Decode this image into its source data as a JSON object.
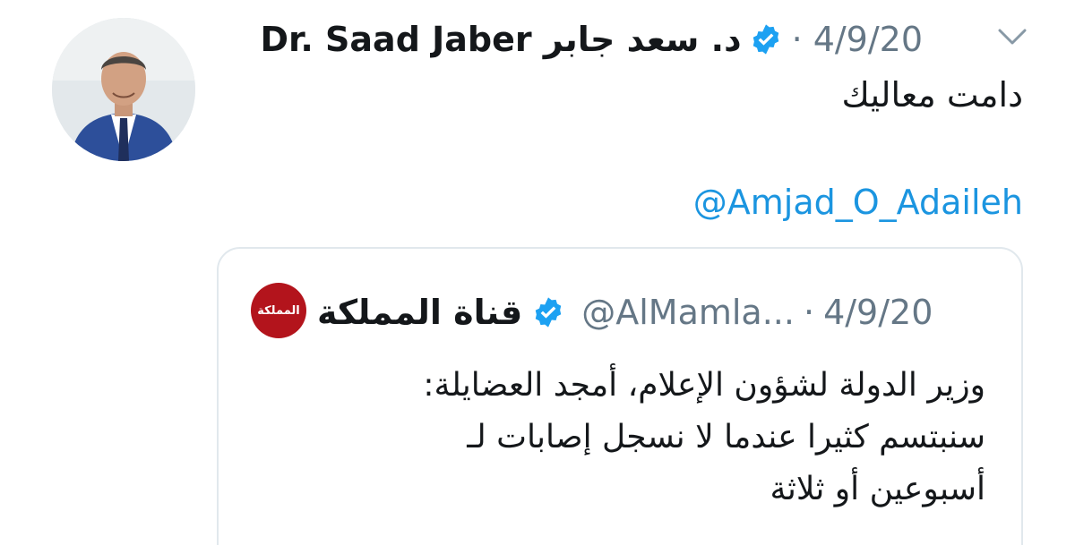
{
  "tweet": {
    "display_name": "Dr. Saad Jaber د. سعد جابر",
    "separator": "·",
    "date": "4/9/20",
    "text": "دامت معاليك",
    "mention": "@Amjad_O_Adaileh"
  },
  "quote": {
    "logo_text": "المملكة",
    "display_name": "قناة المملكة",
    "handle": "@AlMamla...",
    "separator": "·",
    "date": "4/9/20",
    "lines": [
      "وزير الدولة لشؤون الإعلام، أمجد العضايلة:",
      "سنبتسم كثيرا عندما لا نسجل إصابات لـ",
      "أسبوعين أو ثلاثة"
    ]
  },
  "icons": {
    "verified": "verified-badge-icon",
    "caret": "chevron-down-icon"
  },
  "colors": {
    "verified_blue": "#1da1f2",
    "link_blue": "#1b95e0",
    "muted_gray": "#657786",
    "card_border": "#e1e8ed",
    "logo_red": "#b3141c"
  }
}
